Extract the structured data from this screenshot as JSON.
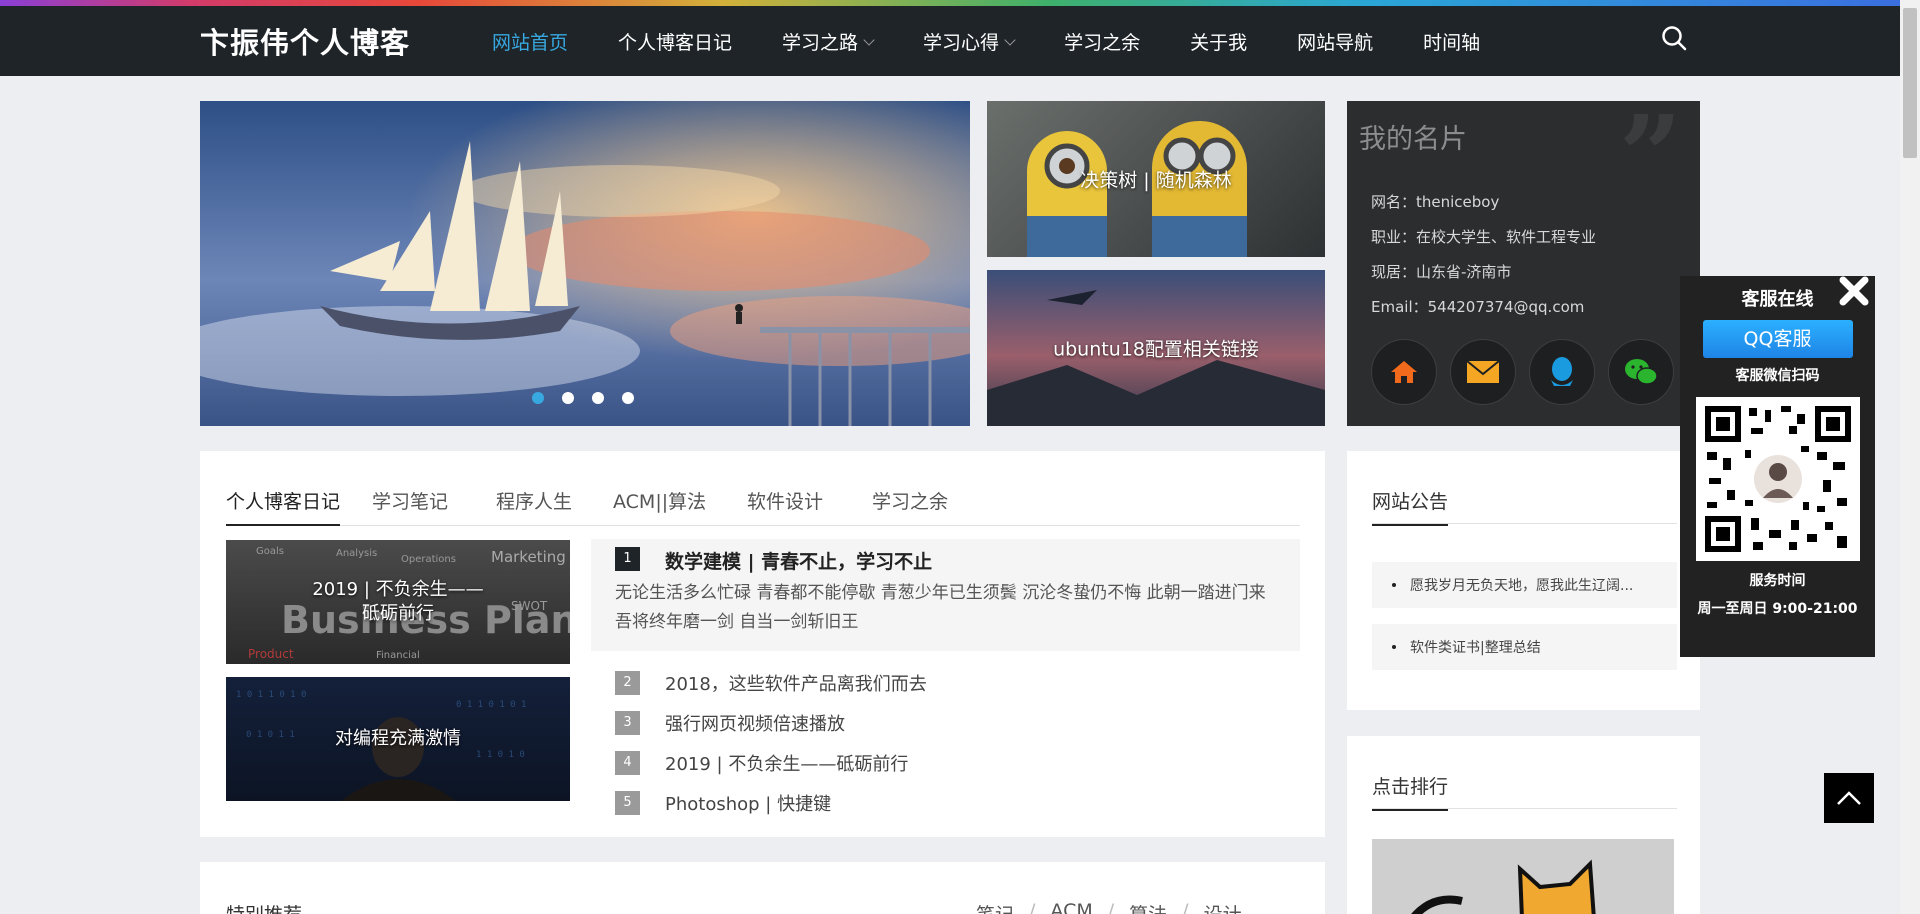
{
  "site": {
    "logo": "卞振伟个人博客"
  },
  "nav": {
    "items": [
      {
        "label": "网站首页",
        "active": true,
        "dropdown": false
      },
      {
        "label": "个人博客日记",
        "active": false,
        "dropdown": false
      },
      {
        "label": "学习之路",
        "active": false,
        "dropdown": true
      },
      {
        "label": "学习心得",
        "active": false,
        "dropdown": true
      },
      {
        "label": "学习之余",
        "active": false,
        "dropdown": false
      },
      {
        "label": "关于我",
        "active": false,
        "dropdown": false
      },
      {
        "label": "网站导航",
        "active": false,
        "dropdown": false
      },
      {
        "label": "时间轴",
        "active": false,
        "dropdown": false
      }
    ],
    "search_icon": "search-icon"
  },
  "slider": {
    "dot_count": 4,
    "active_index": 0
  },
  "featured": [
    {
      "title": "决策树 | 随机森林"
    },
    {
      "title": "ubuntu18配置相关链接"
    }
  ],
  "card": {
    "title": "我的名片",
    "info": [
      "网名：theniceboy",
      "职业：在校大学生、软件工程专业",
      "现居：山东省-济南市",
      "Email：544207374@qq.com"
    ],
    "icons": [
      "home-icon",
      "mail-icon",
      "qq-icon",
      "wechat-icon"
    ]
  },
  "tabs": {
    "items": [
      "个人博客日记",
      "学习笔记",
      "程序人生",
      "ACM||算法",
      "软件设计",
      "学习之余"
    ],
    "active_index": 0
  },
  "mini_posts": [
    {
      "title": "2019 | 不负余生——砥砺前行"
    },
    {
      "title": "对编程充满激情"
    }
  ],
  "top_post": {
    "num": "1",
    "title": "数学建模 | 青春不止，学习不止",
    "desc": "无论生活多么忙碌 青春都不能停歇 青葱少年已生须鬓 沉沦冬蛰仍不悔 此朝一踏进门来 吾将终年磨一剑 自当一剑斩旧王"
  },
  "posts": [
    {
      "num": "2",
      "title": "2018，这些软件产品离我们而去"
    },
    {
      "num": "3",
      "title": "强行网页视频倍速播放"
    },
    {
      "num": "4",
      "title": "2019 | 不负余生——砥砺前行"
    },
    {
      "num": "5",
      "title": "Photoshop | 快捷键"
    }
  ],
  "recommend": {
    "title": "特别推荐",
    "links": [
      "笔记",
      "ACM",
      "算法",
      "设计"
    ]
  },
  "notice": {
    "title": "网站公告",
    "items": [
      "愿我岁月无负天地，愿我此生辽阔...",
      "软件类证书|整理总结"
    ]
  },
  "rank": {
    "title": "点击排行"
  },
  "service": {
    "title": "客服在线",
    "qq_button": "QQ客服",
    "wechat_label": "客服微信扫码",
    "time_label": "服务时间",
    "time": "周一至周日 9:00-21:00"
  }
}
